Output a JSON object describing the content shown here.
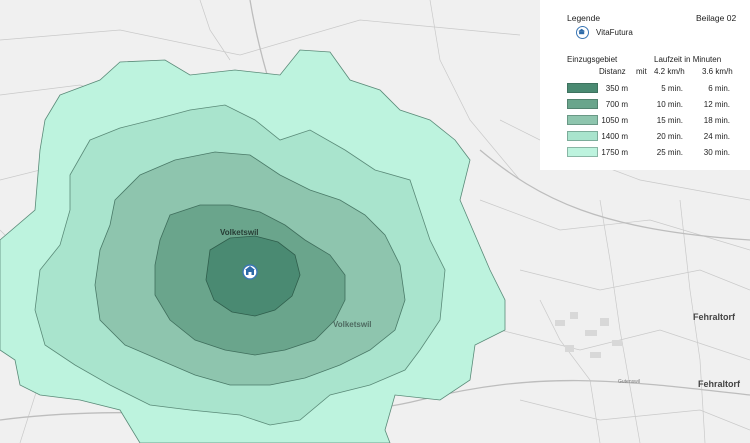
{
  "legend": {
    "title": "Legende",
    "sheet": "Beilage 02",
    "marker_label": "VitaFutura",
    "table": {
      "header_zone": "Einzugsgebiet",
      "header_time": "Laufzeit in Minuten",
      "col_distance": "Distanz",
      "col_mit": "mit",
      "col_speed1": "4.2 km/h",
      "col_speed2": "3.6 km/h",
      "rows": [
        {
          "color": "#4a8a72",
          "distance": "350 m",
          "time1": "5 min.",
          "time2": "6 min."
        },
        {
          "color": "#6aa58c",
          "distance": "700 m",
          "time1": "10 min.",
          "time2": "12 min."
        },
        {
          "color": "#8ec5ae",
          "distance": "1050 m",
          "time1": "15 min.",
          "time2": "18 min."
        },
        {
          "color": "#a9e4cd",
          "distance": "1400 m",
          "time1": "20 min.",
          "time2": "24 min."
        },
        {
          "color": "#bdf3de",
          "distance": "1750 m",
          "time1": "25 min.",
          "time2": "30 min."
        }
      ]
    }
  },
  "map": {
    "places": {
      "volketswil_1": "Volketswil",
      "volketswil_2": "Volketswil",
      "fehraltorf_1": "Fehraltorf",
      "fehraltorf_2": "Fehraltorf",
      "gutenswil": "Gutenswil"
    },
    "marker_icon": "building-icon"
  }
}
